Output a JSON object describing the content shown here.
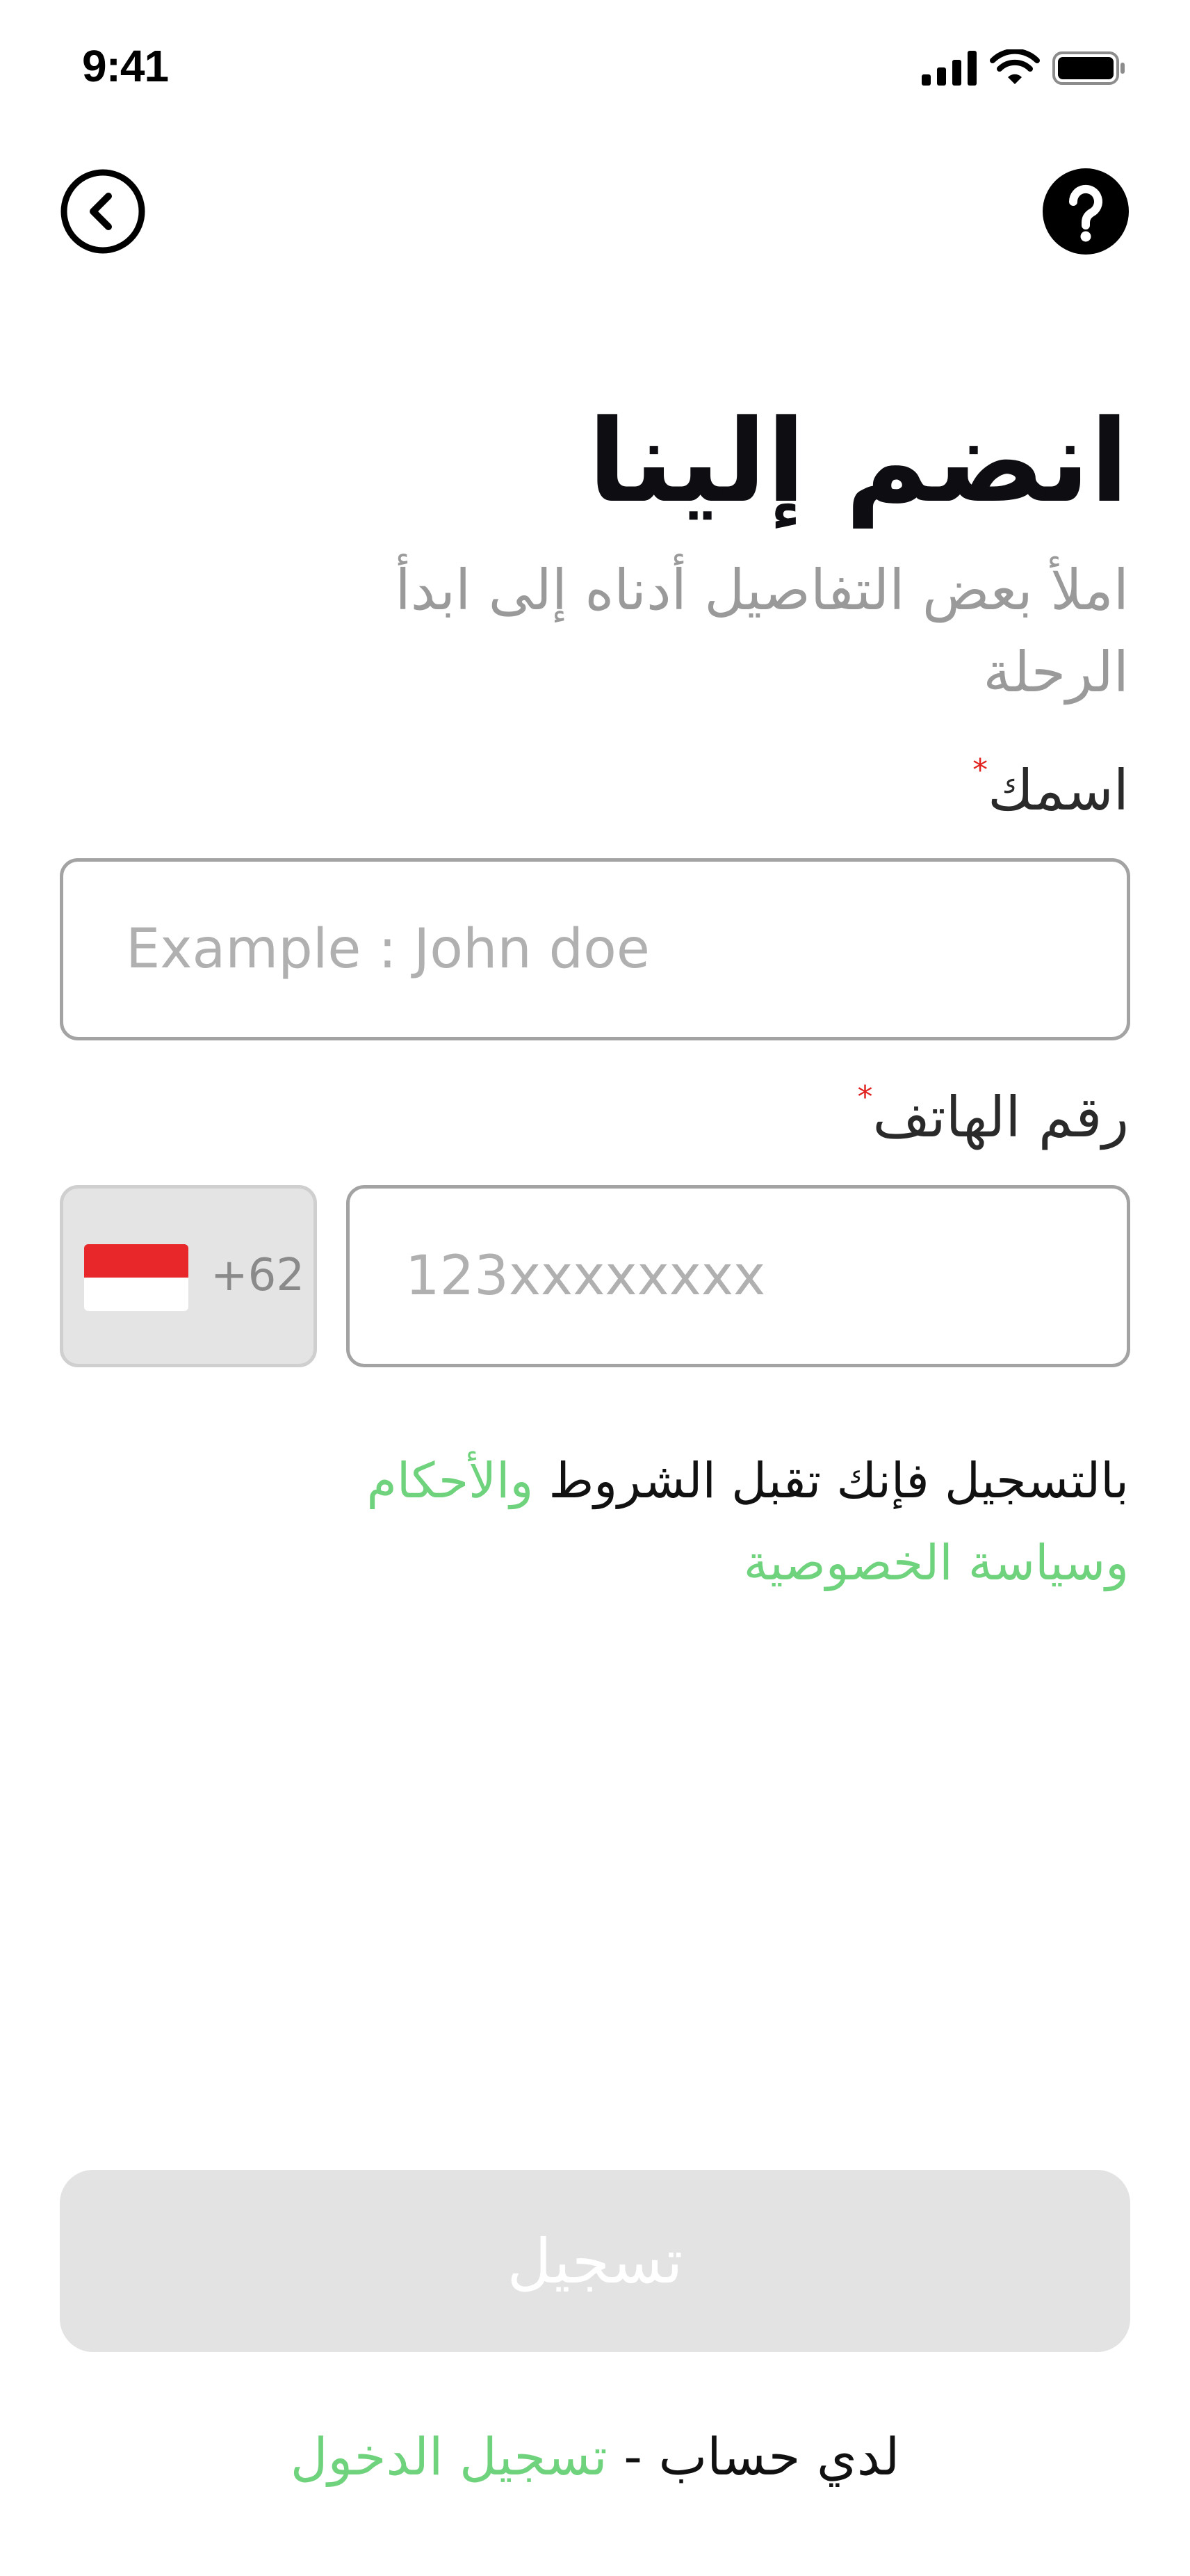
{
  "status_bar": {
    "time": "9:41"
  },
  "icons": {
    "back": "chevron-left-circle-icon",
    "help": "question-circle-icon",
    "signal": "cellular-signal-icon",
    "wifi": "wifi-icon",
    "battery": "battery-icon"
  },
  "header": {
    "title": "انضم إلينا",
    "subtitle": "املأ بعض التفاصيل أدناه إلى ابدأ الرحلة"
  },
  "form": {
    "name_label": "اسمك",
    "name_placeholder": "Example : John doe",
    "name_value": "",
    "phone_label": "رقم الهاتف",
    "required_mark": "*",
    "country_code": "+62",
    "phone_placeholder": "123xxxxxxxx",
    "phone_value": ""
  },
  "terms": {
    "prefix": "بالتسجيل فإنك تقبل الشروط ",
    "terms_link": "والأحكام",
    "privacy_link": "وسياسة الخصوصية"
  },
  "actions": {
    "register_label": "تسجيل",
    "have_account_text": "لدي حساب - ",
    "login_link": "تسجيل الدخول"
  },
  "colors": {
    "accent_green": "#6fd27d",
    "required_red": "#e0211d",
    "disabled_button": "#e3e3e3",
    "flag_red": "#e8272a"
  }
}
